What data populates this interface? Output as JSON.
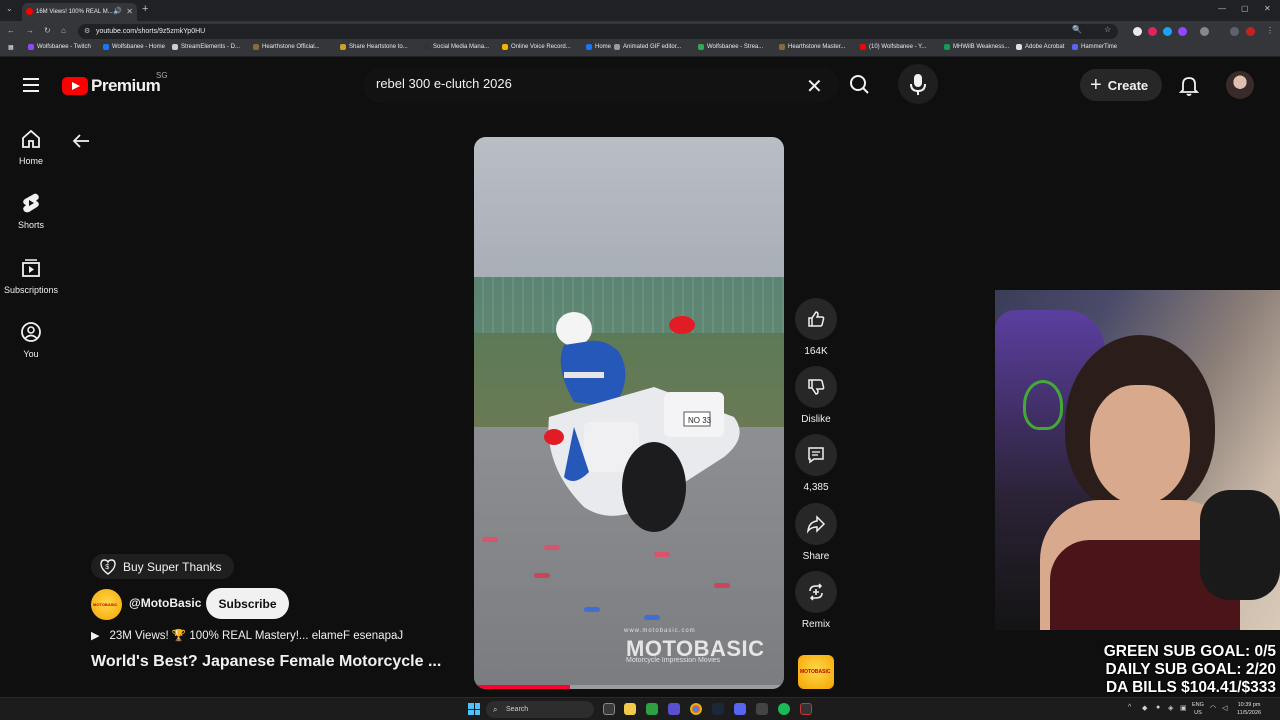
{
  "browser": {
    "tab_title": "16M Views! 100% REAL M...",
    "url": "youtube.com/shorts/9z5zmkYp0HU",
    "bookmarks": [
      {
        "label": "Wolfsbanee - Twitch",
        "color": "#9146ff"
      },
      {
        "label": "Wolfsbanee - Home",
        "color": "#1877f2"
      },
      {
        "label": "StreamElements - D...",
        "color": "#cccccc"
      },
      {
        "label": "Hearthstone Official...",
        "color": "#8a6b3a"
      },
      {
        "label": "Share Heartstone to...",
        "color": "#c9a227"
      },
      {
        "label": "Social Media Mana...",
        "color": "#333333"
      },
      {
        "label": "Online Voice Record...",
        "color": "#f4b400"
      },
      {
        "label": "Home",
        "color": "#1877f2"
      },
      {
        "label": "Animated GIF editor...",
        "color": "#999999"
      },
      {
        "label": "Wolfsbanee - Strea...",
        "color": "#34a853"
      },
      {
        "label": "Hearthstone Master...",
        "color": "#8a6b3a"
      },
      {
        "label": "(10) Wolfsbanee - Y...",
        "color": "#ff0000"
      },
      {
        "label": "MHWilB Weakness...",
        "color": "#0f9d58"
      },
      {
        "label": "Adobe Acrobat",
        "color": "#e0e0e0"
      },
      {
        "label": "HammerTime",
        "color": "#5865f2"
      }
    ]
  },
  "header": {
    "logo_text": "Premium",
    "region": "SG",
    "search_query": "rebel 300 e-clutch 2026",
    "create_label": "Create"
  },
  "sidebar": {
    "items": [
      {
        "label": "Home",
        "icon": "home-icon"
      },
      {
        "label": "Shorts",
        "icon": "shorts-icon"
      },
      {
        "label": "Subscriptions",
        "icon": "subscriptions-icon"
      },
      {
        "label": "You",
        "icon": "you-icon"
      }
    ]
  },
  "video": {
    "watermark_small": "www.motobasic.com",
    "watermark_brand": "MOTOBASIC",
    "watermark_tagline": "Motorcycle Impression Movies",
    "plate_text": "NO 33",
    "progress": 0.31
  },
  "actions": {
    "like_count": "164K",
    "dislike_label": "Dislike",
    "comment_count": "4,385",
    "share_label": "Share",
    "remix_label": "Remix",
    "channel_thumb_text": "MOTOBASIC"
  },
  "info": {
    "super_thanks_label": "Buy Super Thanks",
    "channel_handle": "@MotoBasic",
    "channel_avatar_text": "MOTOBASIC",
    "subscribe_label": "Subscribe",
    "description": "23M Views! 🏆 100% REAL Mastery!‮Japanese Female ...",
    "title": "World's Best?  Japanese Female Motorcycle ..."
  },
  "stream_overlay": {
    "goals": [
      "GREEN SUB GOAL: 0/5",
      "DAILY SUB GOAL: 2/20",
      "DA BILLS $104.41/$333"
    ]
  },
  "taskbar": {
    "search_label": "Search",
    "lang_line1": "ENG",
    "lang_line2": "US",
    "time": "10:39 pm",
    "date": "11/5/2026"
  }
}
